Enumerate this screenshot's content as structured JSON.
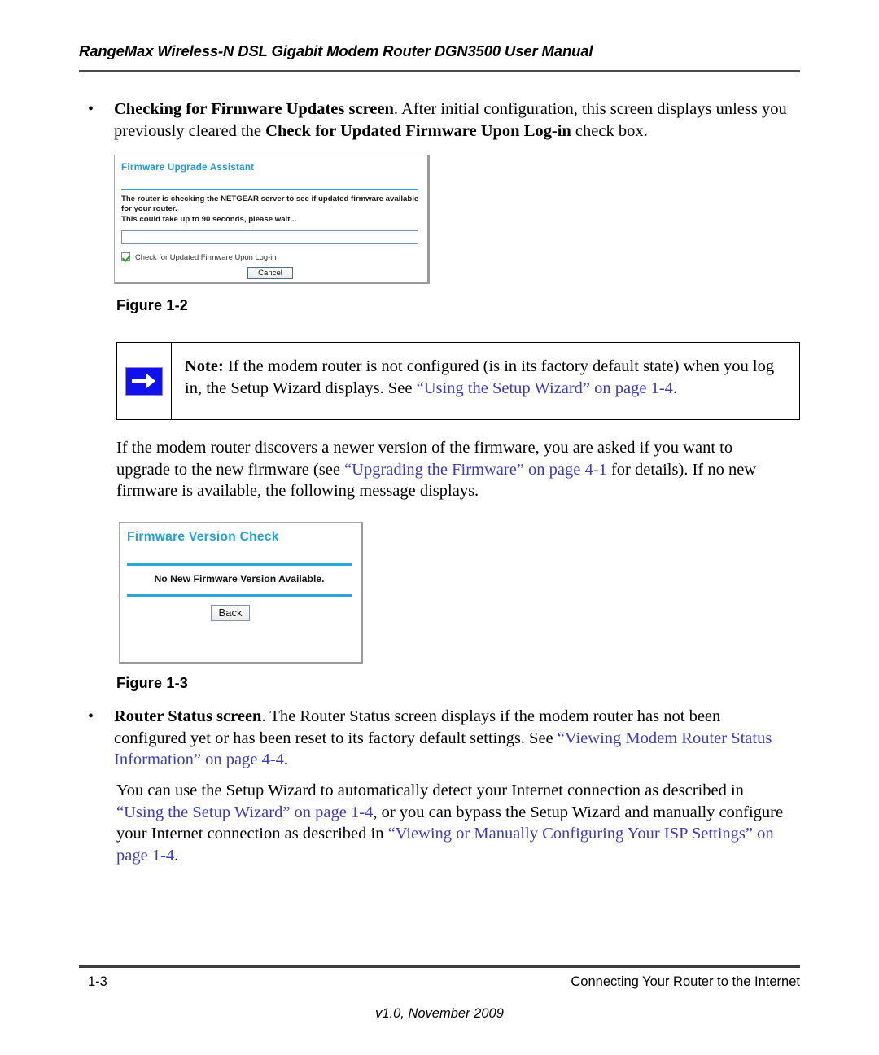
{
  "header": {
    "title": "RangeMax Wireless-N DSL Gigabit Modem Router DGN3500 User Manual"
  },
  "bullets": {
    "marker": "•",
    "firmware_updates": {
      "lead_bold": "Checking for Firmware Updates screen",
      "text_1": ". After initial configuration, this screen displays unless you previously cleared the ",
      "inline_bold": "Check for Updated Firmware Upon Log-in",
      "text_2": " check box."
    },
    "router_status": {
      "lead_bold": "Router Status screen",
      "text_1": ". The Router Status screen displays if the modem router has not been configured yet or has been reset to its factory default settings. See ",
      "link": "“Viewing Modem Router Status Information” on page 4-4",
      "text_2": "."
    }
  },
  "figure1": {
    "title": "Firmware Upgrade Assistant",
    "message_line1": "The router is checking the NETGEAR server to see if updated firmware available for your router.",
    "message_line2": "This could take up to 90 seconds, please wait...",
    "progress_value": "",
    "checkbox_label": "Check for Updated Firmware Upon Log-in",
    "checkbox_checked": "true",
    "cancel_label": "Cancel",
    "caption": "Figure 1-2",
    "title_color": "#2496d4",
    "rule_color": "#29a3de",
    "check_color": "#1aa821"
  },
  "note": {
    "icon": "right-arrow",
    "label_bold": "Note:",
    "text_1": " If the modem router is not configured (is in its factory default state) when you log in, the Setup Wizard displays. See ",
    "link": "“Using the Setup Wizard” on page 1-4",
    "text_2": ".",
    "icon_color": "#1111ee"
  },
  "paragraphs": {
    "newer_version": {
      "text_1": "If the modem router discovers a newer version of the firmware, you are asked if you want to upgrade to the new firmware (see ",
      "link": "“Upgrading the Firmware” on page 4-1",
      "text_2": " for details). If no new firmware is available, the following message displays."
    },
    "setup_wizard": {
      "text_1": "You can use the Setup Wizard to automatically detect your Internet connection as described in ",
      "link_1": "“Using the Setup Wizard” on page 1-4",
      "text_2": ", or you can bypass the Setup Wizard and manually configure your Internet connection as described in ",
      "link_2": "“Viewing or Manually Configuring Your ISP Settings” on page 1-4",
      "text_3": "."
    }
  },
  "figure2": {
    "title": "Firmware Version Check",
    "message": "No New Firmware Version Available.",
    "back_label": "Back",
    "caption": "Figure 1-3",
    "title_color": "#1fa0d6",
    "rule_color": "#2aa6de"
  },
  "footer": {
    "page_number": "1-3",
    "chapter": "Connecting Your Router to the Internet",
    "version": "v1.0, November 2009"
  },
  "colors": {
    "link": "#3b3bbd",
    "rule": "#4a4a4a"
  }
}
